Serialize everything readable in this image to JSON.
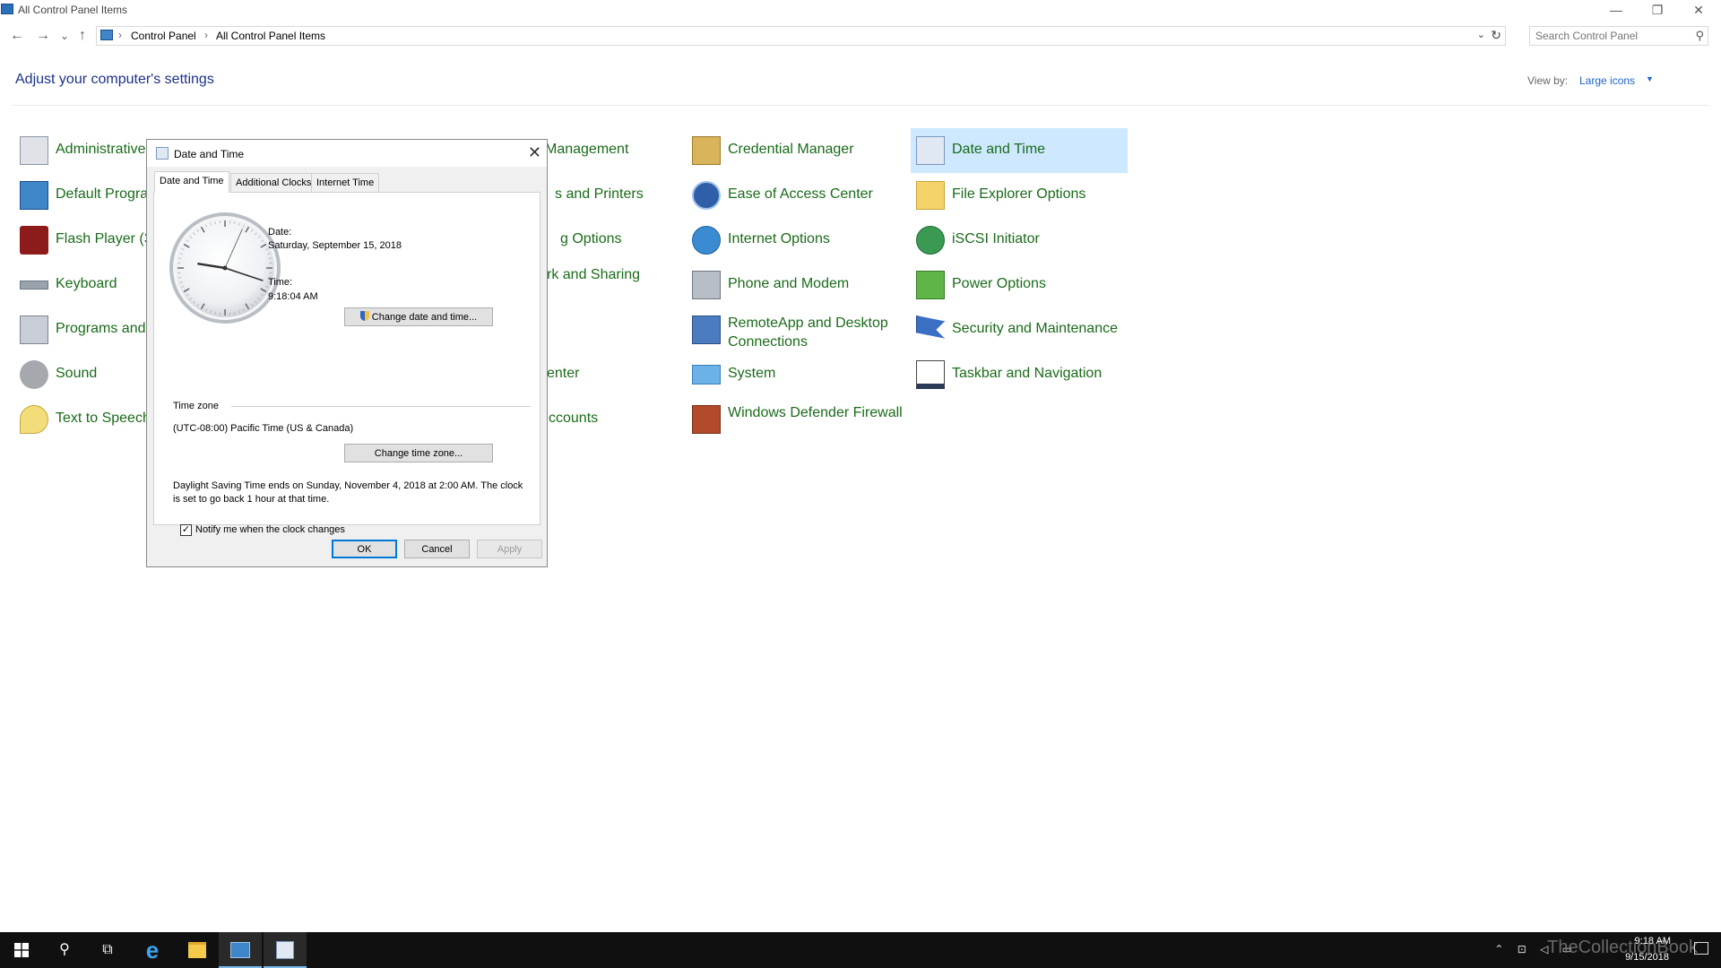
{
  "window": {
    "title": "All Control Panel Items",
    "min_glyph": "—",
    "max_glyph": "❐",
    "close_glyph": "✕"
  },
  "nav": {
    "back_glyph": "←",
    "forward_glyph": "→",
    "recent_glyph": "⌄",
    "up_glyph": "↑",
    "address_dropdown_glyph": "⌄",
    "refresh_glyph": "↻"
  },
  "address": {
    "breadcrumbs": [
      "Control Panel",
      "All Control Panel Items"
    ],
    "separator": "›"
  },
  "search": {
    "placeholder": "Search Control Panel",
    "icon_glyph": "⚲"
  },
  "header": {
    "title": "Adjust your computer's settings",
    "view_by_label": "View by:",
    "view_by_value": "Large icons",
    "chevron": "▼"
  },
  "items": {
    "c1": [
      "Administrative",
      "Default Progra",
      "Flash Player (3",
      "Keyboard",
      "Programs and",
      "Sound",
      "Text to Speech"
    ],
    "c2": [
      "Management",
      "s and Printers",
      "g Options",
      "rk and Sharing",
      "enter",
      "ccounts"
    ],
    "c3": [
      "Credential Manager",
      "Ease of Access Center",
      "Internet Options",
      "Phone and Modem",
      "RemoteApp and Desktop Connections",
      "System",
      "Windows Defender Firewall"
    ],
    "c4": [
      "Date and Time",
      "File Explorer Options",
      "iSCSI Initiator",
      "Power Options",
      "Security and Maintenance",
      "Taskbar and Navigation"
    ]
  },
  "dialog": {
    "title": "Date and Time",
    "close_glyph": "✕",
    "tabs": [
      "Date and Time",
      "Additional Clocks",
      "Internet Time"
    ],
    "date_label": "Date:",
    "date_value": "Saturday, September 15, 2018",
    "time_label": "Time:",
    "time_value": "9:18:04 AM",
    "change_date_button": "Change date and time...",
    "timezone_label": "Time zone",
    "timezone_value": "(UTC-08:00) Pacific Time (US & Canada)",
    "change_timezone_button": "Change time zone...",
    "dst_text": "Daylight Saving Time ends on Sunday, November 4, 2018 at 2:00 AM. The clock is set to go back 1 hour at that time.",
    "notify_label": "Notify me when the clock changes",
    "notify_checked": true,
    "check_glyph": "✓",
    "ok": "OK",
    "cancel": "Cancel",
    "apply": "Apply",
    "clock": {
      "hour": 9,
      "minute": 18,
      "second": 4
    }
  },
  "taskbar": {
    "time": "9:18 AM",
    "date": "9/15/2018",
    "watermark": "TheCollectionBook",
    "search_glyph": "⚲",
    "taskview_glyph": "⧉",
    "ie_glyph": "e",
    "tray_icons": "⌃ ⊡ ◁ ▭"
  },
  "colors": {
    "link_green": "#1a6b1a",
    "title_blue": "#1e3287",
    "accent_blue": "#1c64c6",
    "selection": "#cde8ff",
    "taskbar": "#101010"
  }
}
